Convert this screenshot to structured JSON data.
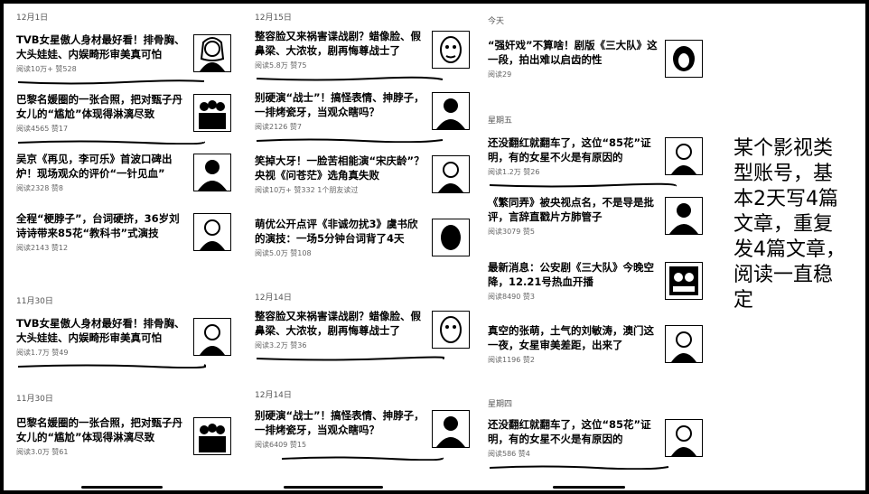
{
  "columns": [
    {
      "groups": [
        {
          "date": "12月1日",
          "items": [
            {
              "title": "TVB女星傲人身材最好看！排骨胸、大头娃娃、内娱畸形审美真可怕",
              "meta": "阅读10万+ 赞528",
              "thumb_icon": "woman-portrait-icon"
            },
            {
              "title": "巴黎名媛圈的一张合照，把对甄子丹女儿的“尴尬”体现得淋漓尽致",
              "meta": "阅读4565 赞17",
              "thumb_icon": "group-photo-icon"
            },
            {
              "title": "吴京《再见，李可乐》首波口碑出炉！现场观众的评价“一针见血”",
              "meta": "阅读2328 赞8",
              "thumb_icon": "man-portrait-icon"
            },
            {
              "title": "全程“梗脖子”，台词硬挤，36岁刘诗诗带来85花“教科书”式演技",
              "meta": "阅读2143 赞12",
              "thumb_icon": "woman-portrait-icon"
            }
          ]
        },
        {
          "date": "11月30日",
          "items": [
            {
              "title": "TVB女星傲人身材最好看！排骨胸、大头娃娃、内娱畸形审美真可怕",
              "meta": "阅读1.7万 赞49",
              "thumb_icon": "woman-portrait-icon"
            }
          ]
        },
        {
          "date": "11月30日",
          "items": [
            {
              "title": "巴黎名媛圈的一张合照，把对甄子丹女儿的“尴尬”体现得淋漓尽致",
              "meta": "阅读3.0万 赞61",
              "thumb_icon": "group-photo-icon"
            }
          ]
        }
      ]
    },
    {
      "groups": [
        {
          "date": "12月15日",
          "items": [
            {
              "title": "整容脸又来祸害谍战剧？蜡像脸、假鼻梁、大浓妆，剧再悔尊战士了",
              "meta": "阅读5.8万 赞75",
              "thumb_icon": "face-closeup-icon"
            },
            {
              "title": "别硬演“战士”！搞怪表情、抻脖子，一排烤瓷牙，当观众瞎吗？",
              "meta": "阅读2126 赞7",
              "thumb_icon": "man-portrait-icon"
            },
            {
              "title": "笑掉大牙！一脸苦相能演“宋庆龄”？央视《问苍茫》选角真失败",
              "meta": "阅读10万+ 赞332 1个朋友读过",
              "thumb_icon": "woman-portrait-icon"
            },
            {
              "title": "萌优公开点评《非诚勿扰3》虞书欣的演技：一场5分钟台词背了4天",
              "meta": "阅读5.0万 赞108",
              "thumb_icon": "face-closeup-icon"
            }
          ]
        },
        {
          "date": "12月14日",
          "items": [
            {
              "title": "整容脸又来祸害谍战剧？蜡像脸、假鼻梁、大浓妆，剧再悔尊战士了",
              "meta": "阅读3.2万 赞36",
              "thumb_icon": "face-closeup-icon"
            }
          ]
        },
        {
          "date": "12月14日",
          "items": [
            {
              "title": "别硬演“战士”！搞怪表情、抻脖子，一排烤瓷牙，当观众瞎吗？",
              "meta": "阅读6409 赞15",
              "thumb_icon": "man-portrait-icon"
            }
          ]
        }
      ]
    },
    {
      "groups": [
        {
          "date": "今天",
          "items": [
            {
              "title": "“强奸戏”不算啥！剧版《三大队》这一段，拍出难以启齿的性",
              "meta": "阅读29",
              "thumb_icon": "face-closeup-icon"
            }
          ]
        },
        {
          "date": "星期五",
          "items": [
            {
              "title": "还没翻红就翻车了，这位“85花”证明，有的女星不火是有原因的",
              "meta": "阅读1.2万 赞26",
              "thumb_icon": "woman-portrait-icon"
            },
            {
              "title": "《繁同弄》被央视点名，不是导是批评，言辞直戳片方肺管子",
              "meta": "阅读3079 赞5",
              "thumb_icon": "man-portrait-icon"
            },
            {
              "title": "最新消息：公安剧《三大队》今晚空降，12.21号热血开播",
              "meta": "阅读8490 赞3",
              "thumb_icon": "poster-icon"
            },
            {
              "title": "真空的张萌，土气的刘敏涛，澳门这一夜，女星审美差距，出来了",
              "meta": "阅读1196 赞2",
              "thumb_icon": "woman-portrait-icon"
            }
          ]
        },
        {
          "date": "星期四",
          "items": [
            {
              "title": "还没翻红就翻车了，这位“85花”证明，有的女星不火是有原因的",
              "meta": "阅读586 赞4",
              "thumb_icon": "woman-portrait-icon"
            }
          ]
        }
      ]
    }
  ],
  "note": "某个影视类型账号，基本2天写4篇文章，重复发4篇文章，阅读一直稳定"
}
